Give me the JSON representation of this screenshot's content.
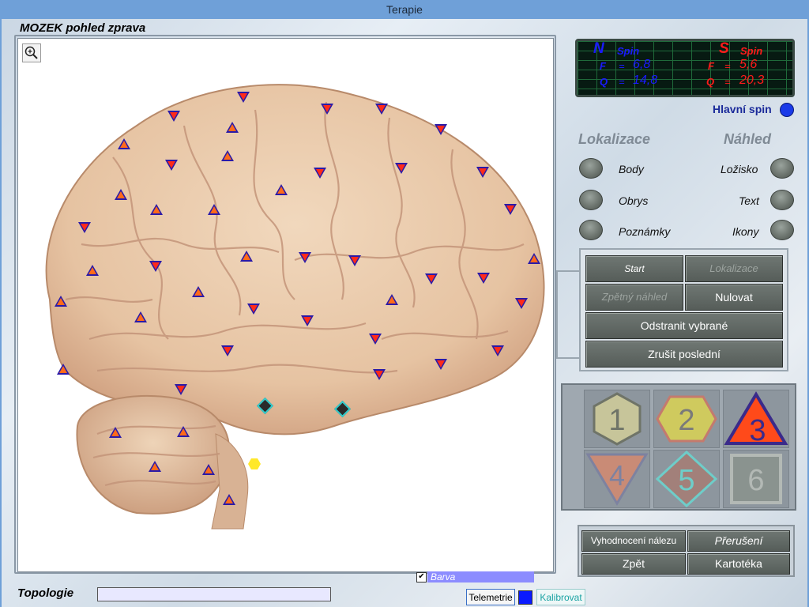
{
  "window": {
    "title": "Terapie"
  },
  "view": {
    "title": "MOZEK pohled zprava",
    "zoom_icon": "magnifier-plus-icon"
  },
  "spin": {
    "n_label": "N",
    "s_label": "S",
    "spin_word": "Spin",
    "f_label": "F",
    "q_label": "Q",
    "eq": "=",
    "n_f": "6,8",
    "n_q": "14,8",
    "s_f": "5,6",
    "s_q": "20,3"
  },
  "hlavni_spin": {
    "label": "Hlavní spin",
    "color": "#1a3ae8"
  },
  "lokalizace": {
    "heading": "Lokalizace",
    "options": [
      "Body",
      "Obrys",
      "Poznámky"
    ]
  },
  "nahled": {
    "heading": "Náhled",
    "options": [
      "Ložisko",
      "Text",
      "Ikony"
    ]
  },
  "controls": {
    "start": "Start",
    "lokalizace": "Lokalizace",
    "zpetny": "Zpětný náhled",
    "nulovat": "Nulovat",
    "odstranit": "Odstranit vybrané",
    "zrusit": "Zrušit poslední"
  },
  "icons": [
    "1",
    "2",
    "3",
    "4",
    "5",
    "6"
  ],
  "bottom_buttons": {
    "vyhodnoceni": "Vyhodnocení nálezu",
    "preruseni": "Přerušení",
    "zpet": "Zpět",
    "kartoteka": "Kartotéka"
  },
  "topologie": {
    "label": "Topologie",
    "value": ""
  },
  "barva": {
    "label": "Barva",
    "checked": true,
    "color": "#8c8cff"
  },
  "tabs": {
    "telemetrie": "Telemetrie",
    "kalibrovat": "Kalibrovat"
  }
}
